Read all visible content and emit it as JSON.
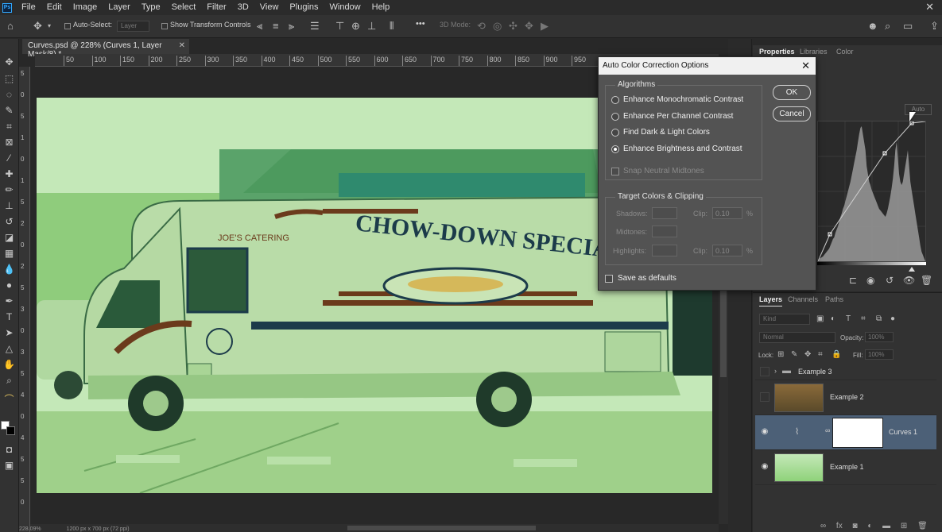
{
  "app": {
    "logo": "Ps"
  },
  "menubar": {
    "items": [
      "File",
      "Edit",
      "Image",
      "Layer",
      "Type",
      "Select",
      "Filter",
      "3D",
      "View",
      "Plugins",
      "Window",
      "Help"
    ]
  },
  "optionsbar": {
    "auto_select_label": "Auto-Select:",
    "auto_select_value": "Layer",
    "show_transform_label": "Show Transform Controls",
    "mode_3d_label": "3D Mode:",
    "more_label": "•••"
  },
  "document": {
    "tab_title": "Curves.psd @ 228% (Curves 1, Layer Mask/8) *",
    "status_zoom": "228.09%",
    "status_info": "1200 px x 700 px (72 ppi)"
  },
  "rulers": {
    "h_ticks": [
      "50",
      "100",
      "150",
      "200",
      "250",
      "300",
      "350",
      "400",
      "450",
      "500",
      "550",
      "600",
      "650",
      "700",
      "750",
      "800",
      "850",
      "900",
      "950"
    ],
    "v_ticks": [
      "5",
      "0",
      "5",
      "1",
      "0",
      "1",
      "5",
      "2",
      "0",
      "2",
      "5",
      "3",
      "0",
      "3",
      "5",
      "4",
      "0",
      "4",
      "5",
      "5",
      "0"
    ]
  },
  "properties_panel": {
    "tabs": [
      "Properties",
      "Libraries",
      "Color"
    ],
    "auto_button": "Auto",
    "colors": {
      "histogram": "#9a9a9a",
      "curve_line": "#d0d0d0"
    }
  },
  "layers_panel": {
    "tabs": [
      "Layers",
      "Channels",
      "Paths"
    ],
    "kind_filter": "Kind",
    "blend_mode": "Normal",
    "opacity_label": "Opacity:",
    "opacity_value": "100%",
    "lock_label": "Lock:",
    "fill_label": "Fill:",
    "fill_value": "100%",
    "layers": [
      {
        "name": "Example 3",
        "type": "group",
        "visible": false
      },
      {
        "name": "Example 2",
        "type": "image",
        "visible": false
      },
      {
        "name": "Curves 1",
        "type": "adjustment",
        "visible": true,
        "selected": true
      },
      {
        "name": "Example 1",
        "type": "image",
        "visible": true
      }
    ]
  },
  "dialog": {
    "title": "Auto Color Correction Options",
    "algorithms_title": "Algorithms",
    "options": [
      {
        "label": "Enhance Monochromatic Contrast",
        "checked": false
      },
      {
        "label": "Enhance Per Channel Contrast",
        "checked": false
      },
      {
        "label": "Find Dark & Light Colors",
        "checked": false
      },
      {
        "label": "Enhance Brightness and Contrast",
        "checked": true
      }
    ],
    "snap_label": "Snap Neutral Midtones",
    "target_title": "Target Colors & Clipping",
    "shadows_label": "Shadows:",
    "midtones_label": "Midtones:",
    "highlights_label": "Highlights:",
    "clip_label": "Clip:",
    "shadow_clip": "0.10",
    "highlight_clip": "0.10",
    "percent": "%",
    "ok_label": "OK",
    "cancel_label": "Cancel",
    "save_defaults_label": "Save as defaults"
  },
  "artwork": {
    "truck_sign": "CHOW-DOWN SPECIAL",
    "cab_sign": "JOE'S CATERING",
    "colors": {
      "tint": "#8fd27a",
      "sky": "#c4e8b8",
      "truck": "#b9dca8",
      "stripe": "#6b3b1c",
      "navy": "#1c3b4a"
    }
  }
}
